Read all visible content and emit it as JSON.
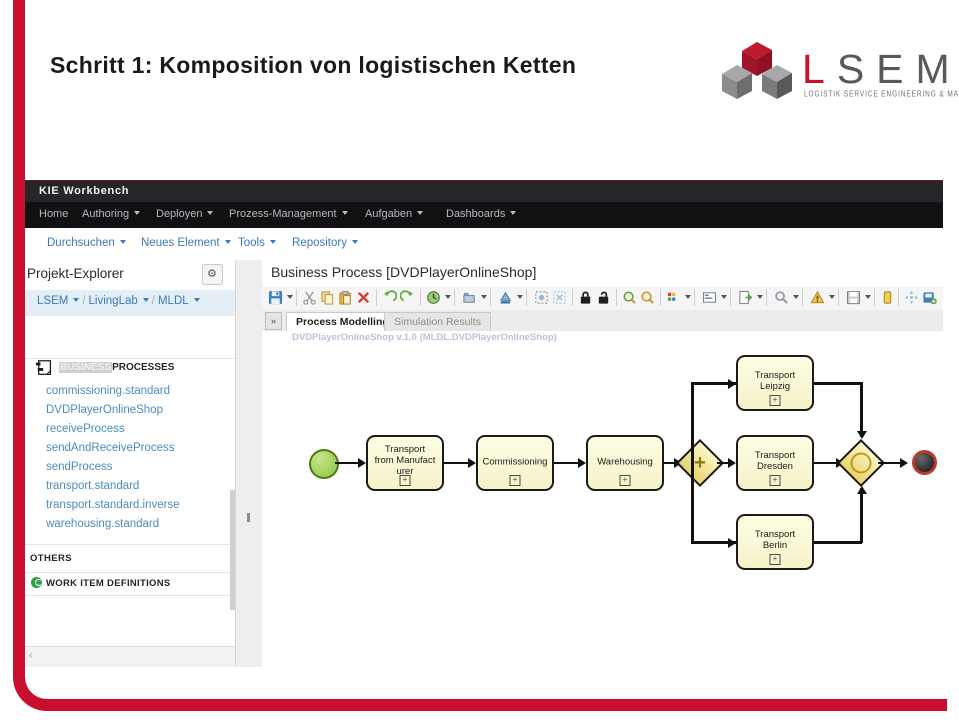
{
  "slide": {
    "title": "Schritt 1: Komposition von logistischen Ketten",
    "accent_color": "#c8102e"
  },
  "logo": {
    "wordmark_l": "L",
    "wordmark_rest": "SEM",
    "tagline": "LOGISTIK SERVICE ENGINEERING & MANAGEMENT",
    "cube_red": "#c0182f",
    "cube_gray": "#9a9a9a",
    "cube_dark": "#58595b"
  },
  "workbench": {
    "brand": "KIE Workbench",
    "nav": [
      {
        "label": "Home",
        "caret": false
      },
      {
        "label": "Authoring",
        "caret": true
      },
      {
        "label": "Deployen",
        "caret": true
      },
      {
        "label": "Prozess-Management",
        "caret": true
      },
      {
        "label": "Aufgaben",
        "caret": true
      },
      {
        "label": "Dashboards",
        "caret": true
      }
    ],
    "sub_nav": [
      {
        "label": "Durchsuchen",
        "caret": true
      },
      {
        "label": "Neues Element",
        "caret": true
      },
      {
        "label": "Tools",
        "caret": true
      },
      {
        "label": "Repository",
        "caret": true
      }
    ]
  },
  "explorer": {
    "title": "Projekt-Explorer",
    "gear_icon": "gear-icon",
    "breadcrumb": [
      "LSEM",
      "LivingLab",
      "MLDL"
    ],
    "business_processes_label_hl": "BUSINESS",
    "business_processes_label_rest": "PROCESSES",
    "files": [
      "commissioning.standard",
      "DVDPlayerOnlineShop",
      "receiveProcess",
      "sendAndReceiveProcess",
      "sendProcess",
      "transport.standard",
      "transport.standard.inverse",
      "warehousing.standard"
    ],
    "others_label": "OTHERS",
    "work_item_definitions_label": "WORK ITEM DEFINITIONS"
  },
  "editor": {
    "title": "Business Process [DVDPlayerOnlineShop]",
    "chevron_label": "»",
    "tabs": [
      {
        "label": "Process Modelling",
        "active": true
      },
      {
        "label": "Simulation Results",
        "active": false
      }
    ],
    "process_label": "DVDPlayerOnlineShop v.1.0 (MLDL.DVDPlayerOnlineShop)",
    "toolbar_icons": [
      "save-icon",
      "save-dropdown-caret",
      "cut-icon",
      "copy-icon",
      "paste-icon",
      "delete-icon",
      "undo-icon",
      "redo-icon",
      "history-icon",
      "history-dropdown-caret",
      "align-icon",
      "align-dropdown-caret",
      "color-icon",
      "color-dropdown-caret",
      "select-icon",
      "deselect-icon",
      "lock-icon",
      "unlock-icon",
      "zoom-in-icon",
      "zoom-out-icon",
      "grid-icon",
      "grid-dropdown-caret",
      "form-icon",
      "form-dropdown-caret",
      "generate-icon",
      "generate-dropdown-caret",
      "search-icon",
      "search-dropdown-caret",
      "validate-icon",
      "validate-dropdown-caret",
      "save-as-icon",
      "save-as-dropdown-caret",
      "delete-process-icon",
      "move-icon",
      "export-icon",
      "import-icon",
      "migrate-icon",
      "fullscreen-icon",
      "view-icon"
    ]
  },
  "diagram": {
    "type": "bpmn-process",
    "nodes": [
      {
        "id": "start",
        "kind": "start-event",
        "label": ""
      },
      {
        "id": "t1",
        "kind": "task",
        "label": "Transport from Manufacturer",
        "collapsed": true
      },
      {
        "id": "t2",
        "kind": "task",
        "label": "Commissioning",
        "collapsed": true
      },
      {
        "id": "t3",
        "kind": "task",
        "label": "Warehousing",
        "collapsed": true
      },
      {
        "id": "gw-split",
        "kind": "parallel-gateway",
        "label": "+"
      },
      {
        "id": "t4",
        "kind": "task",
        "label": "Transport Leipzig",
        "collapsed": true
      },
      {
        "id": "t5",
        "kind": "task",
        "label": "Transport Dresden",
        "collapsed": true
      },
      {
        "id": "t6",
        "kind": "task",
        "label": "Transport Berlin",
        "collapsed": true
      },
      {
        "id": "gw-join",
        "kind": "inclusive-gateway",
        "label": ""
      },
      {
        "id": "end",
        "kind": "end-event",
        "label": ""
      }
    ],
    "task_expand_glyph": "+",
    "task_labels": {
      "t1_line1": "Transport",
      "t1_line2": "from Manufact",
      "t1_line3": "urer",
      "t2": "Commissioning",
      "t3": "Warehousing",
      "t4_line1": "Transport",
      "t4_line2": "Leipzig",
      "t5_line1": "Transport",
      "t5_line2": "Dresden",
      "t6_line1": "Transport",
      "t6_line2": "Berlin"
    }
  }
}
